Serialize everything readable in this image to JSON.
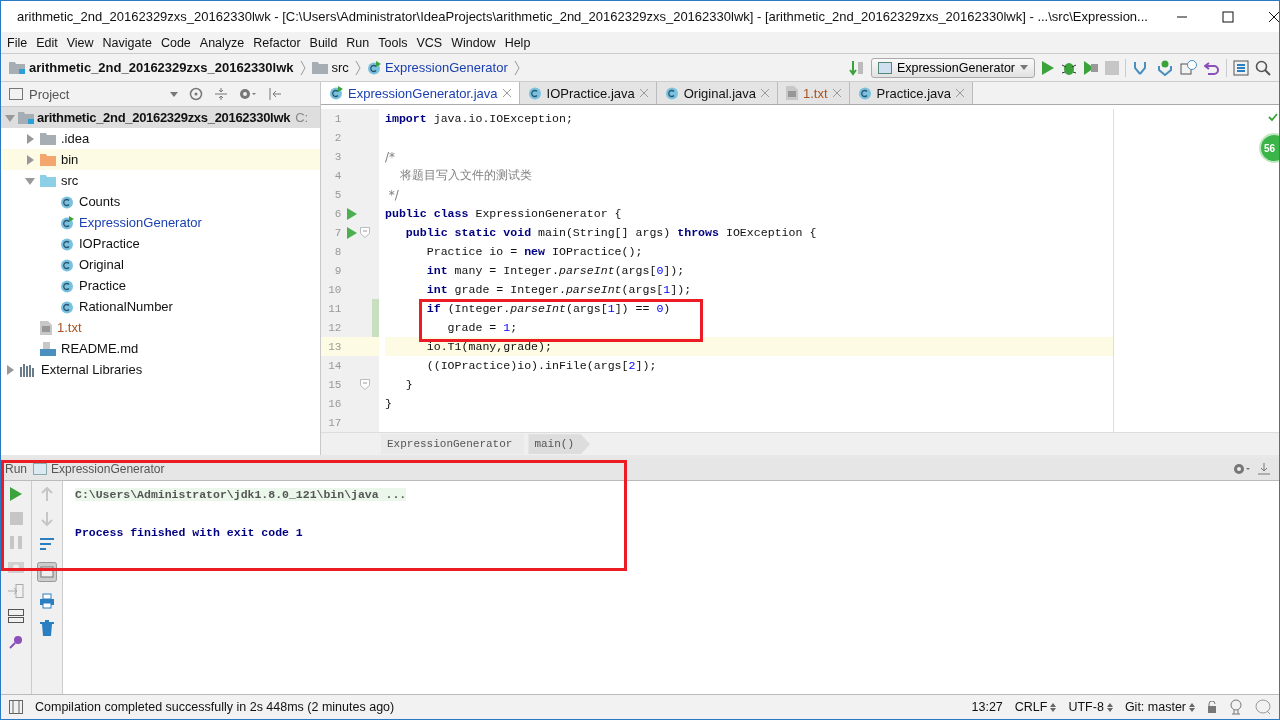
{
  "window": {
    "title": "arithmetic_2nd_20162329zxs_20162330lwk - [C:\\Users\\Administrator\\IdeaProjects\\arithmetic_2nd_20162329zxs_20162330lwk] - [arithmetic_2nd_20162329zxs_20162330lwk] - ...\\src\\Expression..."
  },
  "menu": [
    "File",
    "Edit",
    "View",
    "Navigate",
    "Code",
    "Analyze",
    "Refactor",
    "Build",
    "Run",
    "Tools",
    "VCS",
    "Window",
    "Help"
  ],
  "navbar": {
    "crumbs": [
      {
        "kind": "project",
        "label": "arithmetic_2nd_20162329zxs_20162330lwk"
      },
      {
        "kind": "folder",
        "label": "src"
      },
      {
        "kind": "main-class",
        "label": "ExpressionGenerator"
      }
    ],
    "run_config": "ExpressionGenerator"
  },
  "project_panel": {
    "title": "Project",
    "tree": [
      {
        "kind": "project",
        "label": "arithmetic_2nd_20162329zxs_20162330lwk",
        "path": "C:",
        "expanded": true,
        "highlighted": false,
        "children": [
          {
            "kind": "folder",
            "label": ".idea",
            "expanded": false,
            "highlighted": false
          },
          {
            "kind": "excluded-folder",
            "label": "bin",
            "expanded": false,
            "highlighted": true
          },
          {
            "kind": "source-folder",
            "label": "src",
            "expanded": true,
            "highlighted": false,
            "children": [
              {
                "kind": "class",
                "label": "Counts",
                "highlighted": false
              },
              {
                "kind": "main-class",
                "label": "ExpressionGenerator",
                "highlighted": false
              },
              {
                "kind": "class",
                "label": "IOPractice",
                "highlighted": false
              },
              {
                "kind": "class",
                "label": "Original",
                "highlighted": false
              },
              {
                "kind": "class",
                "label": "Practice",
                "highlighted": false
              },
              {
                "kind": "class",
                "label": "RationalNumber",
                "highlighted": false
              }
            ]
          },
          {
            "kind": "text-file",
            "label": "1.txt",
            "highlighted": false
          },
          {
            "kind": "markdown",
            "label": "README.md",
            "highlighted": false
          }
        ]
      },
      {
        "kind": "library",
        "label": "External Libraries",
        "expanded": false,
        "highlighted": false
      }
    ]
  },
  "tabs": [
    {
      "kind": "main-class",
      "label": "ExpressionGenerator.java",
      "selected": true
    },
    {
      "kind": "class",
      "label": "IOPractice.java",
      "selected": false
    },
    {
      "kind": "class",
      "label": "Original.java",
      "selected": false
    },
    {
      "kind": "text-file",
      "label": "1.txt",
      "selected": false
    },
    {
      "kind": "class",
      "label": "Practice.java",
      "selected": false
    }
  ],
  "editor": {
    "badge": "56",
    "lines": [
      {
        "n": "1",
        "run": false,
        "fold": false,
        "changed": false,
        "current": false,
        "tokens": [
          {
            "kind": "kw",
            "text": "import"
          },
          {
            "kind": "plain",
            "text": " java.io.IOException;"
          }
        ]
      },
      {
        "n": "2",
        "run": false,
        "fold": false,
        "changed": false,
        "current": false
      },
      {
        "n": "3",
        "run": false,
        "fold": false,
        "changed": false,
        "current": false,
        "tokens": [
          {
            "kind": "comment",
            "text": "/*"
          }
        ]
      },
      {
        "n": "4",
        "run": false,
        "fold": false,
        "changed": false,
        "current": false,
        "tokens": [
          {
            "kind": "comment",
            "text": "    将题目写入文件的测试类"
          }
        ]
      },
      {
        "n": "5",
        "run": false,
        "fold": false,
        "changed": false,
        "current": false,
        "tokens": [
          {
            "kind": "comment",
            "text": " */"
          }
        ]
      },
      {
        "n": "6",
        "run": true,
        "fold": false,
        "changed": false,
        "current": false,
        "tokens": [
          {
            "kind": "kw",
            "text": "public class"
          },
          {
            "kind": "plain",
            "text": " ExpressionGenerator {"
          }
        ]
      },
      {
        "n": "7",
        "run": true,
        "fold": true,
        "changed": false,
        "current": false,
        "tokens": [
          {
            "kind": "kw",
            "text": "   public static void"
          },
          {
            "kind": "plain",
            "text": " main(String[] args) "
          },
          {
            "kind": "kw",
            "text": "throws"
          },
          {
            "kind": "plain",
            "text": " IOException {"
          }
        ]
      },
      {
        "n": "8",
        "run": false,
        "fold": false,
        "changed": false,
        "current": false,
        "tokens": [
          {
            "kind": "plain",
            "text": "      Practice io = "
          },
          {
            "kind": "kw",
            "text": "new"
          },
          {
            "kind": "plain",
            "text": " IOPractice();"
          }
        ]
      },
      {
        "n": "9",
        "run": false,
        "fold": false,
        "changed": false,
        "current": false,
        "tokens": [
          {
            "kind": "kw",
            "text": "      int"
          },
          {
            "kind": "plain",
            "text": " many = Integer."
          },
          {
            "kind": "static",
            "text": "parseInt"
          },
          {
            "kind": "plain",
            "text": "(args["
          },
          {
            "kind": "num",
            "text": "0"
          },
          {
            "kind": "plain",
            "text": "]);"
          }
        ]
      },
      {
        "n": "10",
        "run": false,
        "fold": false,
        "changed": false,
        "current": false,
        "tokens": [
          {
            "kind": "kw",
            "text": "      int"
          },
          {
            "kind": "plain",
            "text": " grade = Integer."
          },
          {
            "kind": "static",
            "text": "parseInt"
          },
          {
            "kind": "plain",
            "text": "(args["
          },
          {
            "kind": "num",
            "text": "1"
          },
          {
            "kind": "plain",
            "text": "]);"
          }
        ]
      },
      {
        "n": "11",
        "run": false,
        "fold": false,
        "changed": true,
        "current": false,
        "tokens": [
          {
            "kind": "kw",
            "text": "      if"
          },
          {
            "kind": "plain",
            "text": " (Integer."
          },
          {
            "kind": "static",
            "text": "parseInt"
          },
          {
            "kind": "plain",
            "text": "(args["
          },
          {
            "kind": "num",
            "text": "1"
          },
          {
            "kind": "plain",
            "text": "]) == "
          },
          {
            "kind": "num",
            "text": "0"
          },
          {
            "kind": "plain",
            "text": ")"
          }
        ]
      },
      {
        "n": "12",
        "run": false,
        "fold": false,
        "changed": true,
        "current": false,
        "tokens": [
          {
            "kind": "plain",
            "text": "         grade = "
          },
          {
            "kind": "num",
            "text": "1"
          },
          {
            "kind": "plain",
            "text": ";"
          }
        ]
      },
      {
        "n": "13",
        "run": false,
        "fold": false,
        "changed": false,
        "current": true,
        "tokens": [
          {
            "kind": "plain",
            "text": "      io.T1(many,grade);"
          }
        ]
      },
      {
        "n": "14",
        "run": false,
        "fold": false,
        "changed": false,
        "current": false,
        "tokens": [
          {
            "kind": "plain",
            "text": "      ((IOPractice)io).inFile(args["
          },
          {
            "kind": "num",
            "text": "2"
          },
          {
            "kind": "plain",
            "text": "]);"
          }
        ]
      },
      {
        "n": "15",
        "run": false,
        "fold": true,
        "changed": false,
        "current": false,
        "tokens": [
          {
            "kind": "plain",
            "text": "   }"
          }
        ]
      },
      {
        "n": "16",
        "run": false,
        "fold": false,
        "changed": false,
        "current": false,
        "tokens": [
          {
            "kind": "plain",
            "text": "}"
          }
        ]
      },
      {
        "n": "17",
        "run": false,
        "fold": false,
        "changed": false,
        "current": false
      }
    ],
    "breadcrumbs": [
      "ExpressionGenerator",
      "main()"
    ]
  },
  "run_panel": {
    "label": "Run",
    "config": "ExpressionGenerator",
    "console": [
      {
        "kind": "command",
        "text": "C:\\Users\\Administrator\\jdk1.8.0_121\\bin\\java ..."
      },
      {
        "kind": "system",
        "text": "Process finished with exit code 1"
      }
    ]
  },
  "status_bar": {
    "message": "Compilation completed successfully in 2s 448ms (2 minutes ago)",
    "position": "13:27",
    "line_separator": "CRLF",
    "encoding": "UTF-8",
    "vcs": "Git: master"
  }
}
